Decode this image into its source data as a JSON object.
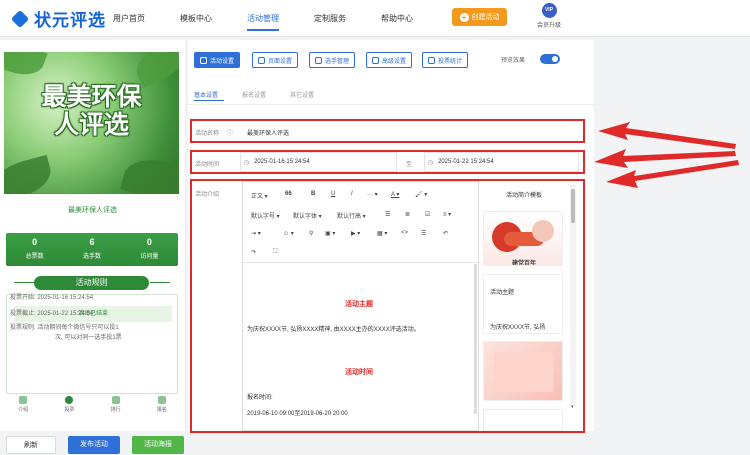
{
  "brand": {
    "name": "状元评选"
  },
  "nav": {
    "items": [
      "用户首页",
      "模板中心",
      "活动管理",
      "定制服务",
      "帮助中心"
    ],
    "active_index": 2
  },
  "header": {
    "create_label": "创建活动",
    "vip_badge": "VIP",
    "vip_label": "会员升级"
  },
  "left": {
    "banner_line1": "最美环保",
    "banner_line2": "人评选",
    "title": "最美环保人评选",
    "stats": [
      {
        "num": "0",
        "label": "总票数"
      },
      {
        "num": "6",
        "label": "选手数"
      },
      {
        "num": "0",
        "label": "访问量"
      }
    ],
    "rules_title": "活动规则",
    "ended": "活动已结束",
    "vote_start": "投票开始: 2025-01-16 15:24:54",
    "vote_end": "投票截止: 2025-01-22 15:24:54",
    "vote_rule_1": "投票规则: 活动期间每个微信号只可以投1",
    "vote_rule_2": "次, 可以对同一选手投1票",
    "tabs": [
      "介绍",
      "投票",
      "排行",
      "报名"
    ],
    "buttons": {
      "refresh": "刷新",
      "publish": "发布活动",
      "poster": "活动海报"
    }
  },
  "toolbar": {
    "buttons": [
      "活动设置",
      "页面设置",
      "选手管理",
      "高级设置",
      "投票统计"
    ],
    "preview_label": "预览效果"
  },
  "subtabs": [
    "基本设置",
    "报名设置",
    "其它设置"
  ],
  "form": {
    "name_label": "活动名称",
    "name_value": "最美环保人评选",
    "time_label": "活动时间",
    "time_start": "2025-01-16 15:24:54",
    "time_sep": "至",
    "time_end": "2025-01-22 15:24:54",
    "intro_label": "活动介绍"
  },
  "editor": {
    "toolbar_row1": [
      "正文",
      "66",
      "B",
      "U",
      "I",
      "···",
      "A",
      "🖌"
    ],
    "toolbar_row2": [
      "默认字号",
      "默认字体",
      "默认行高"
    ],
    "heading1": "活动主题",
    "body1": "为庆祝XXXX节, 弘扬XXXX精神, 由XXXX主办的XXXX评选活动。",
    "heading2": "活动时间",
    "body2": "报名时间:",
    "body3": "2019-06-10 09:00至2019-06-20 20:00"
  },
  "templates": {
    "title": "活动简介模板",
    "card1_caption": "建党百年",
    "card2_title": "活动主题",
    "card2_text": "为庆祝XXXX节, 弘扬"
  },
  "colors": {
    "brand": "#1565d8",
    "accent": "#2b6fe0",
    "green": "#2e8a38",
    "orange": "#f39a1e",
    "annotation": "#e02a2a"
  }
}
